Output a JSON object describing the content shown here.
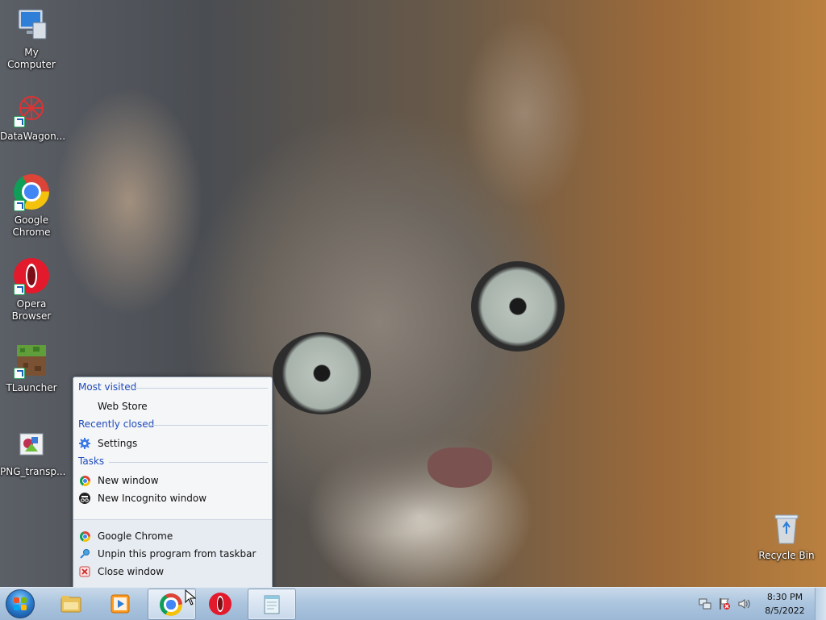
{
  "desktop": {
    "icons": [
      {
        "name": "My Computer",
        "glyph": "computer-icon"
      },
      {
        "name": "DataWagon...",
        "glyph": "datawagon-icon"
      },
      {
        "name": "Google Chrome",
        "glyph": "chrome-icon"
      },
      {
        "name": "Opera Browser",
        "glyph": "opera-icon"
      },
      {
        "name": "TLauncher",
        "glyph": "tlauncher-icon"
      },
      {
        "name": "PNG_transp...",
        "glyph": "png-file-icon"
      },
      {
        "name": "Recycle Bin",
        "glyph": "recycle-bin-icon"
      }
    ]
  },
  "jumplist": {
    "most_visited": {
      "header": "Most visited",
      "items": [
        {
          "label": "Web Store"
        }
      ]
    },
    "recently_closed": {
      "header": "Recently closed",
      "items": [
        {
          "label": "Settings",
          "icon": "gear-icon"
        }
      ]
    },
    "tasks": {
      "header": "Tasks",
      "items": [
        {
          "label": "New window",
          "icon": "chrome-icon"
        },
        {
          "label": "New Incognito window",
          "icon": "incognito-icon"
        }
      ]
    },
    "footer": [
      {
        "label": "Google Chrome",
        "icon": "chrome-icon"
      },
      {
        "label": "Unpin this program from taskbar",
        "icon": "unpin-icon"
      },
      {
        "label": "Close window",
        "icon": "close-window-icon"
      }
    ]
  },
  "taskbar": {
    "pinned": [
      "explorer-icon",
      "media-player-icon",
      "chrome-icon",
      "opera-icon",
      "notepad-icon"
    ],
    "active": "chrome-icon",
    "tray": {
      "time": "8:30 PM",
      "date": "8/5/2022",
      "icons": [
        "network-icon",
        "action-center-icon",
        "volume-icon"
      ]
    }
  },
  "colors": {
    "accent": "#1e4bbb",
    "taskbar": "#adc6df"
  }
}
